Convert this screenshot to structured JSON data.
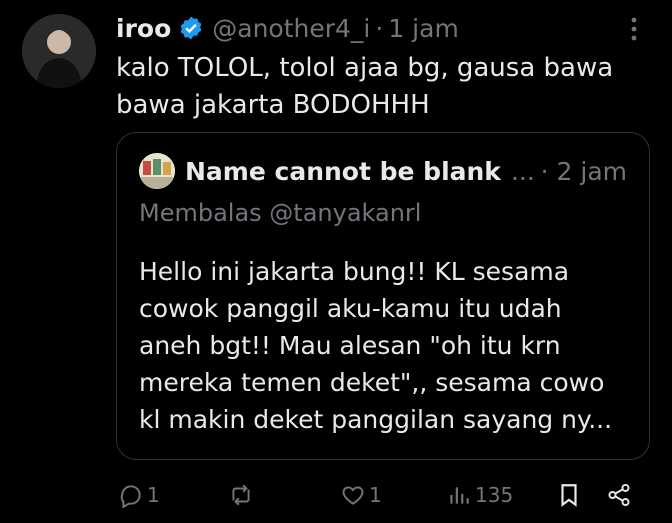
{
  "tweet": {
    "name": "iroo",
    "handle": "@another4_i",
    "sep": "·",
    "time": "1 jam",
    "text": "kalo TOLOL, tolol ajaa bg, gausa bawa bawa jakarta BODOHHH"
  },
  "quoted": {
    "name": "Name cannot be blank",
    "ellipsis": "...",
    "time": "· 2 jam",
    "reply_to": "Membalas @tanyakanrl",
    "text": "Hello ini jakarta bung!! KL sesama cowok panggil aku-kamu itu udah aneh bgt!! Mau alesan \"oh itu krn mereka temen deket\",, sesama cowo kl makin deket panggilan sayang ny..."
  },
  "actions": {
    "replies": "1",
    "reposts": "",
    "likes": "1",
    "views": "135"
  },
  "colors": {
    "background": "#000000",
    "text": "#e7e9ea",
    "muted": "#71767b",
    "verified": "#1d9bf0",
    "border": "#2f3336"
  },
  "icons": [
    "verified-badge-icon",
    "more-icon",
    "reply-icon",
    "repost-icon",
    "like-icon",
    "views-icon",
    "bookmark-icon",
    "share-icon"
  ]
}
